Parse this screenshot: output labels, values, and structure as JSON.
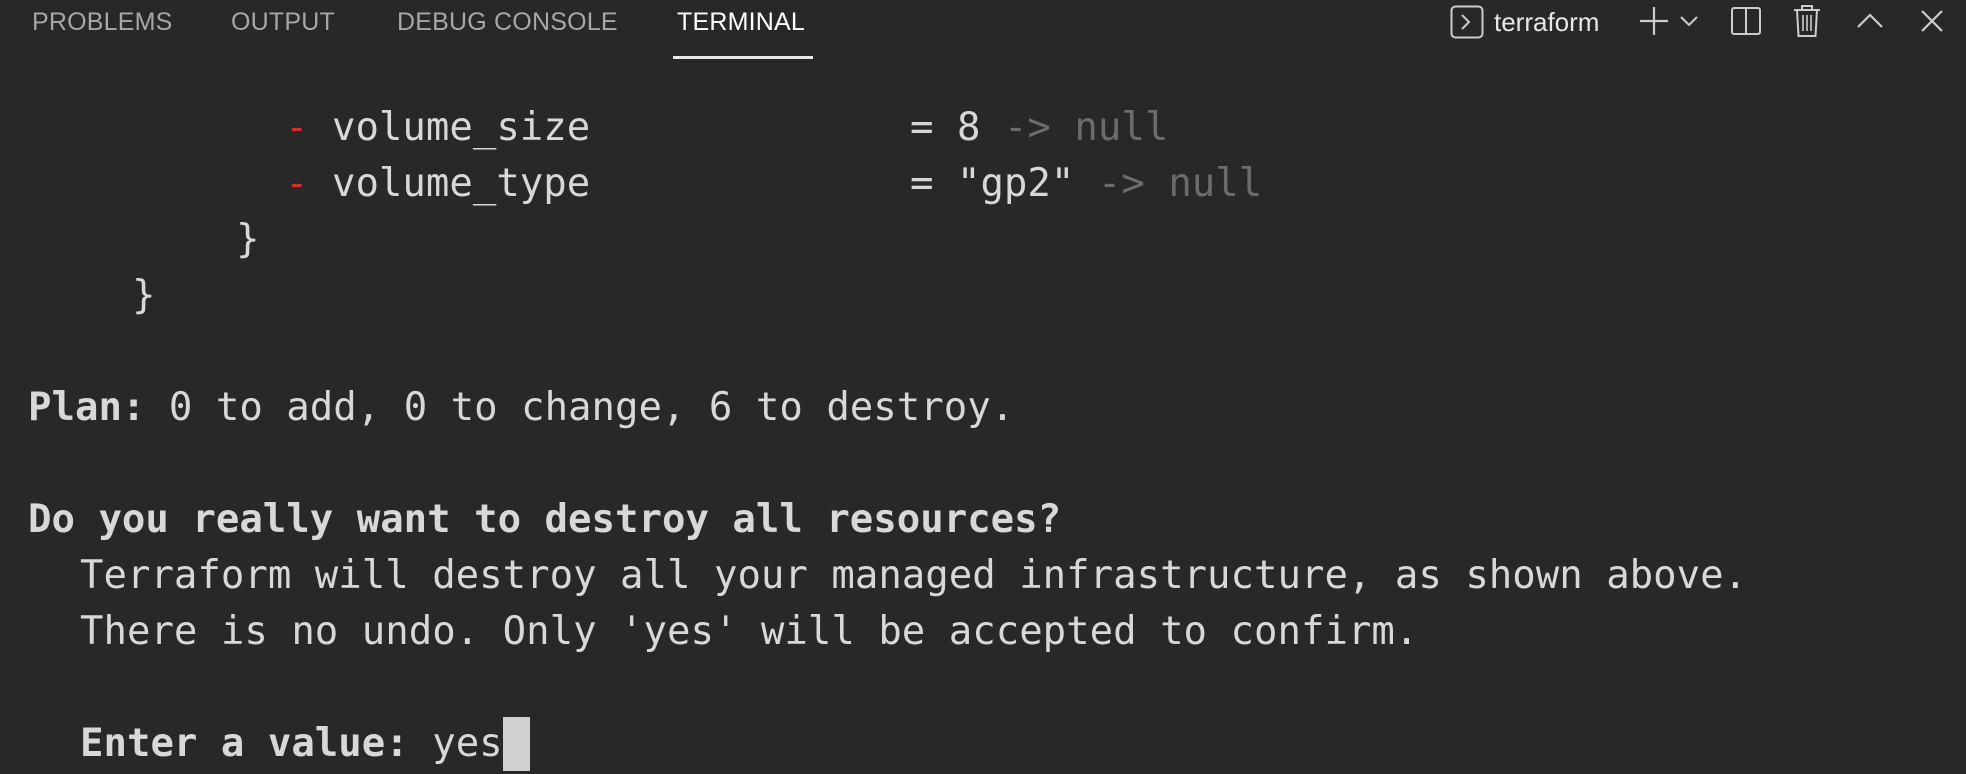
{
  "panel": {
    "tabs": [
      {
        "label": "PROBLEMS"
      },
      {
        "label": "OUTPUT"
      },
      {
        "label": "DEBUG CONSOLE"
      },
      {
        "label": "TERMINAL",
        "active": true
      }
    ],
    "terminal_name": "terraform",
    "toolbar_icons": [
      "terminal-shell-icon",
      "plus-icon",
      "chevron-down-icon",
      "split-terminal-icon",
      "trash-icon",
      "chevron-up-icon",
      "close-icon"
    ]
  },
  "terminal": {
    "diff_rows": [
      {
        "sign": "-",
        "key": "volume_size",
        "eq": "=",
        "old": "8",
        "arrow": "->",
        "new": "null"
      },
      {
        "sign": "-",
        "key": "volume_type",
        "eq": "=",
        "old": "\"gp2\"",
        "arrow": "->",
        "new": "null"
      }
    ],
    "brace_inner": "}",
    "brace_outer": "}",
    "plan_label": "Plan:",
    "plan_text": "0 to add, 0 to change, 6 to destroy.",
    "question": "Do you really want to destroy all resources?",
    "warning_line1": "Terraform will destroy all your managed infrastructure, as shown above.",
    "warning_line2": "There is no undo. Only 'yes' will be accepted to confirm.",
    "prompt_label": "Enter a value:",
    "input_value": "yes"
  },
  "colors": {
    "background": "#282828",
    "minus": "#d0312d",
    "dim": "#6c6c6c",
    "text": "#d8d8d8"
  }
}
